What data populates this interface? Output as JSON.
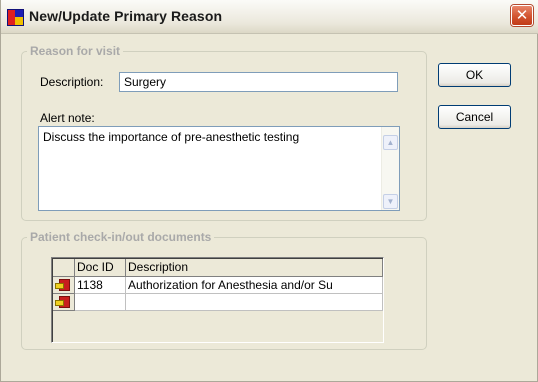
{
  "window": {
    "title": "New/Update Primary Reason",
    "close_glyph": "✕"
  },
  "reason": {
    "group_label": "Reason for visit",
    "description_label": "Description:",
    "description_value": "Surgery",
    "alert_label": "Alert note:",
    "alert_text": "Discuss the importance of pre-anesthetic testing"
  },
  "buttons": {
    "ok": "OK",
    "cancel": "Cancel"
  },
  "documents": {
    "group_label": "Patient check-in/out documents",
    "columns": [
      "Doc ID",
      "Description"
    ],
    "rows": [
      {
        "doc_id": "1138",
        "description": "Authorization for Anesthesia and/or Su"
      },
      {
        "doc_id": "",
        "description": ""
      }
    ],
    "row_icon": "document-exit-icon"
  },
  "scroll": {
    "up_glyph": "▲",
    "down_glyph": "▼"
  }
}
